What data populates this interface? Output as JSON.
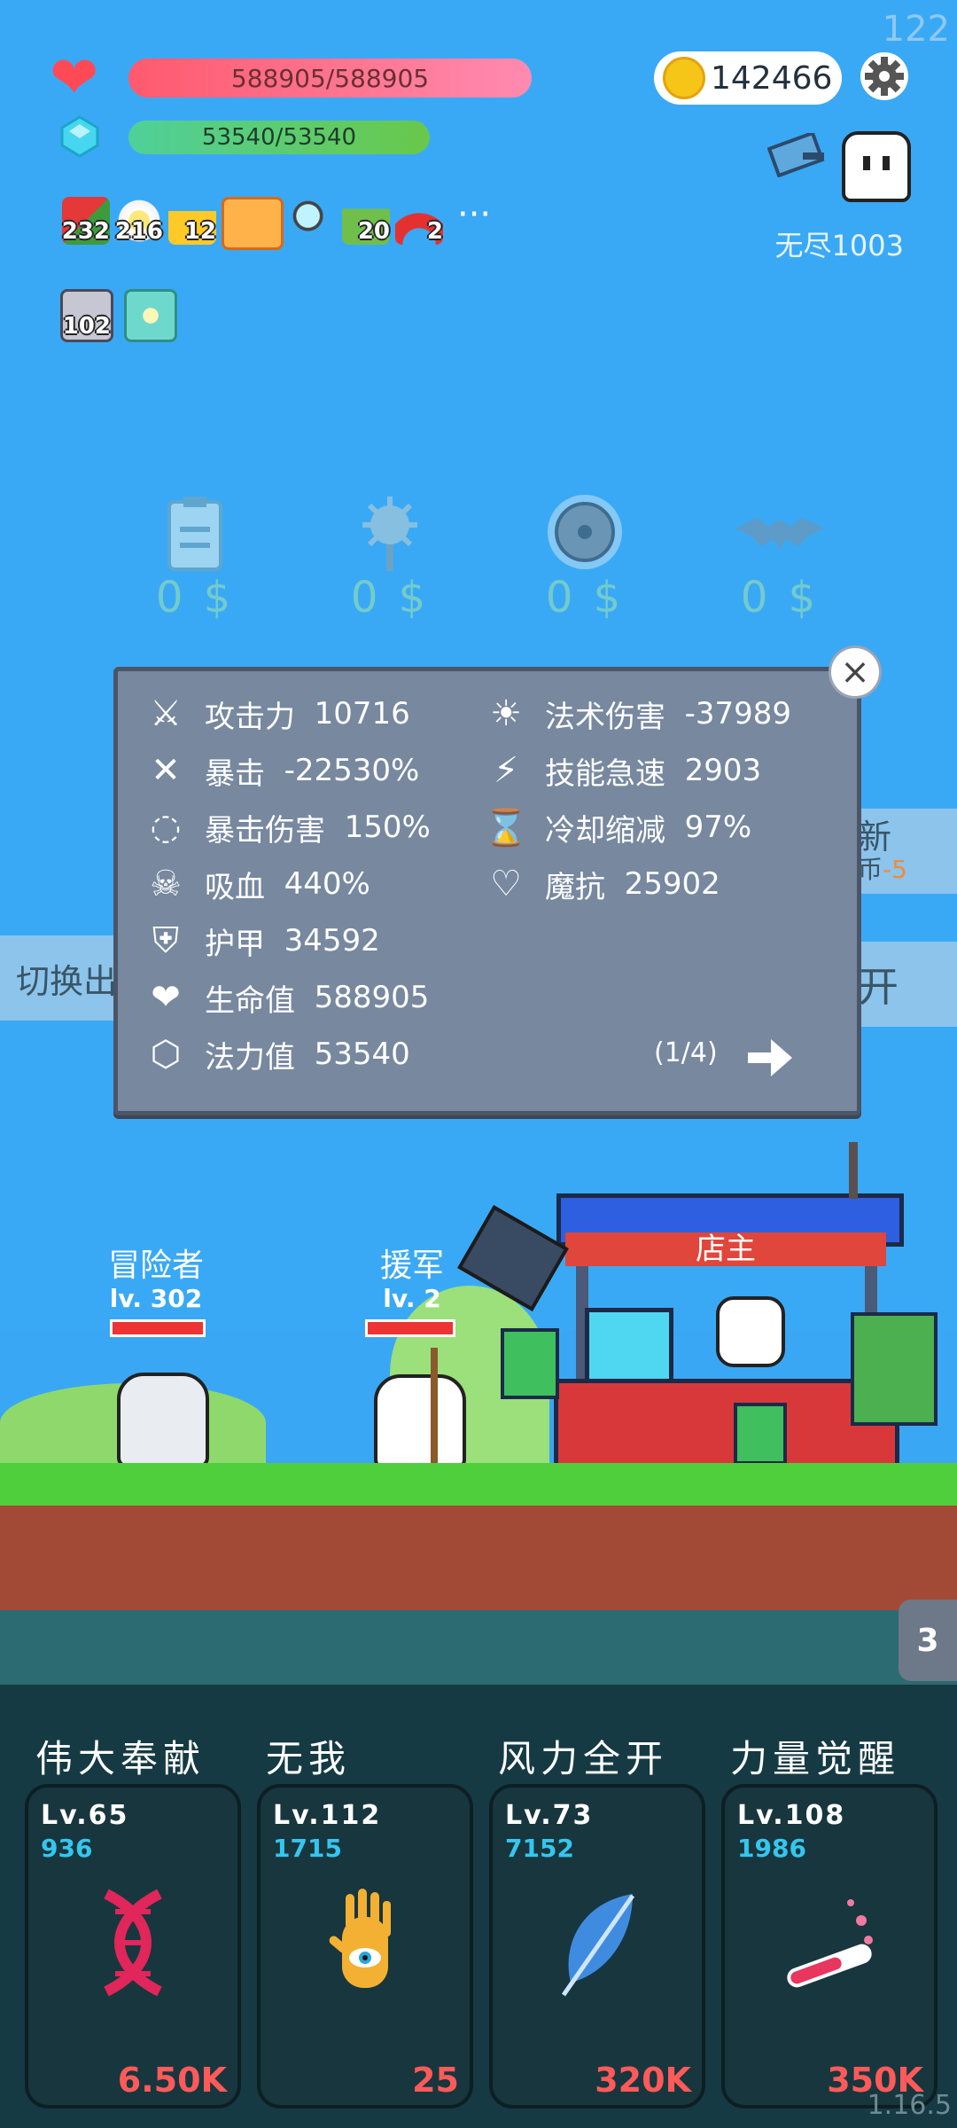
{
  "fps": "122",
  "hud": {
    "hp_text": "588905/588905",
    "mp_text": "53540/53540",
    "coins": "142466",
    "mode_label": "无尽1003"
  },
  "buffs_row1": [
    {
      "icon": "watermelon-icon",
      "count": "232"
    },
    {
      "icon": "flower-icon",
      "count": "216"
    },
    {
      "icon": "crown-icon",
      "count": "12"
    },
    {
      "icon": "scroll-book-icon",
      "count": ""
    },
    {
      "icon": "magnifier-icon",
      "count": ""
    },
    {
      "icon": "money-heart-icon",
      "count": "20"
    },
    {
      "icon": "magnet-icon",
      "count": "2"
    }
  ],
  "buffs_more": "···",
  "buffs_row2": [
    {
      "icon": "card-stack-icon",
      "count": "102"
    },
    {
      "icon": "lamp-icon",
      "count": ""
    }
  ],
  "shop_slots": [
    {
      "icon": "clipboard-icon",
      "price": "0 $"
    },
    {
      "icon": "spiked-mace-icon",
      "price": "0 $"
    },
    {
      "icon": "shield-disc-icon",
      "price": "0 $"
    },
    {
      "icon": "bat-icon",
      "price": "0 $"
    }
  ],
  "side_buttons": {
    "left_label": "切换出",
    "right_top_label": "新",
    "right_top_sub": "币",
    "right_top_value": "-5",
    "right_bottom_label": "开"
  },
  "stats_panel": {
    "left": [
      {
        "icon": "axe-icon",
        "label": "攻击力",
        "value": "10716"
      },
      {
        "icon": "crossed-swords-icon",
        "label": "暴击",
        "value": "-22530%"
      },
      {
        "icon": "target-ring-icon",
        "label": "暴击伤害",
        "value": "150%"
      },
      {
        "icon": "horned-skull-icon",
        "label": "吸血",
        "value": "440%"
      },
      {
        "icon": "shield-icon",
        "label": "护甲",
        "value": "34592"
      },
      {
        "icon": "heart-icon",
        "label": "生命值",
        "value": "588905"
      },
      {
        "icon": "crystal-icon",
        "label": "法力值",
        "value": "53540"
      }
    ],
    "right": [
      {
        "icon": "sun-icon",
        "label": "法术伤害",
        "value": "-37989"
      },
      {
        "icon": "lightning-icon",
        "label": "技能急速",
        "value": "2903"
      },
      {
        "icon": "hourglass-icon",
        "label": "冷却缩减",
        "value": "97%"
      },
      {
        "icon": "heart-shield-icon",
        "label": "魔抗",
        "value": "25902"
      }
    ],
    "page": "(1/4)"
  },
  "scene": {
    "hero_name": "冒险者",
    "hero_level": "lv. 302",
    "ally_name": "援军",
    "ally_level": "lv. 2",
    "shop_name": "店主"
  },
  "tab_badge": "3",
  "skills": [
    {
      "title": "伟大奉献",
      "level": "Lv.65",
      "value": "936",
      "cost": "6.50K",
      "icon": "dna-icon"
    },
    {
      "title": "无我",
      "level": "Lv.112",
      "value": "1715",
      "cost": "25",
      "icon": "eye-hand-icon"
    },
    {
      "title": "风力全开",
      "level": "Lv.73",
      "value": "7152",
      "cost": "320K",
      "icon": "feather-icon"
    },
    {
      "title": "力量觉醒",
      "level": "Lv.108",
      "value": "1986",
      "cost": "350K",
      "icon": "potion-tube-icon"
    }
  ],
  "version": "1.16.5"
}
